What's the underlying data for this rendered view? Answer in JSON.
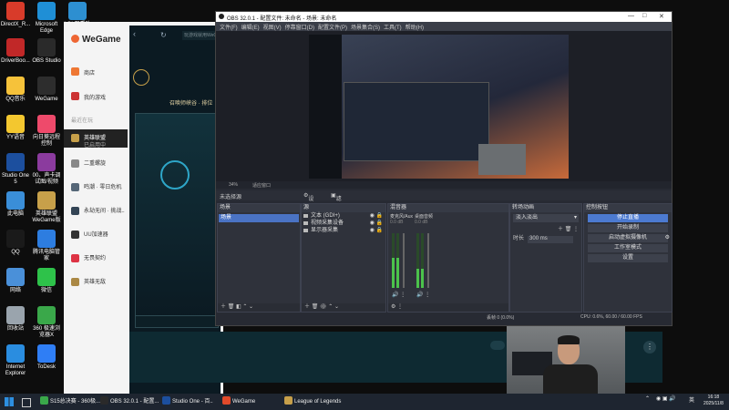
{
  "desktop": {
    "icons": [
      {
        "label": "DirectX_R...",
        "color": "#d83b2a"
      },
      {
        "label": "Microsoft Edge",
        "color": "#1f8fd6"
      },
      {
        "label": "LOL观看助手",
        "color": "#2d8fd1"
      },
      {
        "label": "DriverBoo...",
        "color": "#c12828"
      },
      {
        "label": "OBS Studio",
        "color": "#2a2a2a"
      },
      {
        "label": "QQ音乐",
        "color": "#f6c23a"
      },
      {
        "label": "WeGame",
        "color": "#2d2d2d"
      },
      {
        "label": "YY语音",
        "color": "#f3c72f"
      },
      {
        "label": "向日葵远程控制",
        "color": "#ee4a6b"
      },
      {
        "label": "Studio One 5",
        "color": "#1c4f9e"
      },
      {
        "label": "00、声卡调试图/视频",
        "color": "#8b3b9e"
      },
      {
        "label": "此电脑",
        "color": "#3a8ed8"
      },
      {
        "label": "英雄联盟WeGame版",
        "color": "#c7a04a"
      },
      {
        "label": "QQ",
        "color": "#1a1a1a"
      },
      {
        "label": "腾讯电脑管家",
        "color": "#2d7de0"
      },
      {
        "label": "网络",
        "color": "#4a90d9"
      },
      {
        "label": "微信",
        "color": "#2ec24a"
      },
      {
        "label": "回收站",
        "color": "#9aa4ad"
      },
      {
        "label": "360 极速浏览器X",
        "color": "#3aa84a"
      },
      {
        "label": "Internet Explorer",
        "color": "#2a8de0"
      },
      {
        "label": "ToDesk",
        "color": "#2f7ef5"
      }
    ]
  },
  "wegame": {
    "brand": "WeGame",
    "nav": [
      {
        "label": "商店",
        "color": "#ee7733"
      },
      {
        "label": "我的游戏",
        "color": "#cc3333"
      }
    ],
    "section_title": "最近在玩",
    "games": [
      {
        "label": "英雄联盟",
        "sub": "已启用中",
        "color": "#c7a04a",
        "selected": true
      },
      {
        "label": "二重螺旋",
        "sub": "",
        "color": "#888888",
        "selected": false
      },
      {
        "label": "鸣潮 · 零日危机",
        "sub": "",
        "color": "#556677",
        "selected": false
      },
      {
        "label": "永劫无间 · 挑战..",
        "sub": "",
        "color": "#334455",
        "selected": false
      },
      {
        "label": "UU加速器",
        "sub": "",
        "color": "#333333",
        "selected": false
      },
      {
        "label": "无畏契约",
        "sub": "",
        "color": "#dd3344",
        "selected": false
      },
      {
        "label": "英雄无敌",
        "sub": "",
        "color": "#aa8844",
        "selected": false
      }
    ],
    "search_placeholder": "玩游戏就用WeGame",
    "lol_header": "召唤师峡谷 · 排位"
  },
  "obs": {
    "title": "OBS 32.0.1 - 配置文件: 未命名 - 场景: 未命名",
    "menu": [
      "文件(F)",
      "编辑(E)",
      "视图(V)",
      "停靠窗口(D)",
      "配置文件(P)",
      "场景集合(S)",
      "工具(T)",
      "帮助(H)"
    ],
    "preview_zoom": "34%",
    "preview_mode": "适应窗口",
    "no_source_selected": "未选择源",
    "tabs": {
      "properties": "设置",
      "filters": "滤镜"
    },
    "scenes": {
      "title": "场景",
      "items": [
        "场景"
      ]
    },
    "sources": {
      "title": "源",
      "items": [
        "文本 (GDI+)",
        "视频采集设备",
        "显示器采集"
      ]
    },
    "mixer": {
      "title": "混音器",
      "channels": [
        {
          "label": "麦克风/Aux",
          "db": "0.0 dB",
          "level": 0.55
        },
        {
          "label": "桌面音频",
          "db": "0.0 dB",
          "level": 0.35
        }
      ]
    },
    "transitions": {
      "title": "转场动画",
      "selected": "淡入淡出",
      "duration_label": "时长",
      "duration": "300 ms"
    },
    "controls": {
      "title": "控制按钮",
      "buttons": [
        "停止直播",
        "开始录制",
        "启动虚拟摄像机",
        "工作室模式",
        "设置"
      ]
    },
    "status": {
      "dropped": "丢帧 0 (0.0%)",
      "cpu_fps": "CPU: 0.6%, 60.00 / 60.00 FPS"
    }
  },
  "taskbar": {
    "items": [
      {
        "label": "S15总决赛 - 360极...",
        "color": "#3aa84a"
      },
      {
        "label": "OBS 32.0.1 - 配置...",
        "color": "#2a2a2a"
      },
      {
        "label": "Studio One - 百..",
        "color": "#1c4f9e"
      },
      {
        "label": "WeGame",
        "color": "#e14a2a"
      },
      {
        "label": "League of Legends",
        "color": "#c7a04a"
      }
    ],
    "ime": "英",
    "time": "16:18",
    "date": "2025/11/8"
  }
}
